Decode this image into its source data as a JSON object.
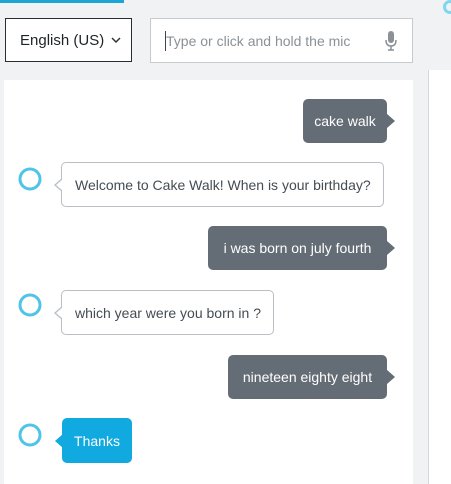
{
  "header": {
    "language_value": "English (US)",
    "input_placeholder": "Type or click and hold the mic",
    "input_value": ""
  },
  "colors": {
    "accent": "#1ca6d6",
    "user_bubble": "#646d75",
    "alexa_highlight": "#10a9e0",
    "alexa_ring": "#4fc3e8"
  },
  "icons": {
    "language_dropdown": "chevron-down-icon",
    "mic": "microphone-icon",
    "assistant_avatar": "alexa-ring-icon"
  },
  "messages": [
    {
      "from": "user",
      "text": "cake walk"
    },
    {
      "from": "alexa",
      "text": "Welcome to Cake Walk! When is your birthday?"
    },
    {
      "from": "user",
      "text": "i was born on july fourth"
    },
    {
      "from": "alexa",
      "text": "which year were you born in ?"
    },
    {
      "from": "user",
      "text": "nineteen eighty eight"
    },
    {
      "from": "alexa",
      "text": "Thanks",
      "highlighted": true
    }
  ]
}
